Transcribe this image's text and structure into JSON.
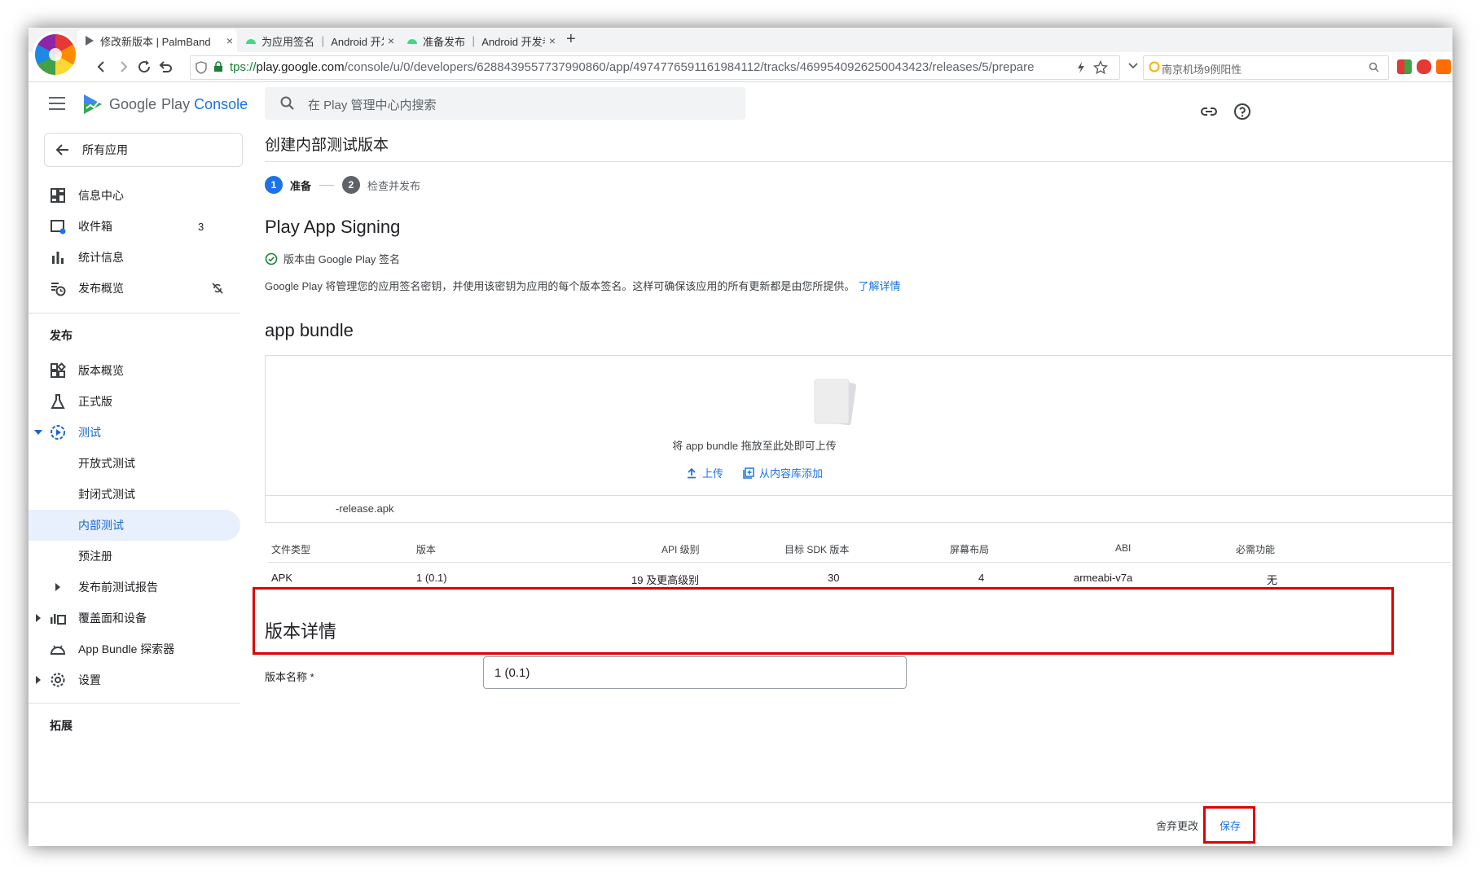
{
  "browser": {
    "tabs": [
      {
        "title": "修改新版本 | PalmBand",
        "active": true
      },
      {
        "title": "为应用签名 ｜ Android 开发者",
        "active": false
      },
      {
        "title": "准备发布 ｜ Android 开发者 ｜",
        "active": false
      }
    ],
    "close_glyph": "×",
    "new_tab_glyph": "+",
    "url_scheme": "tps://",
    "url_host": "play.google.com",
    "url_path": "/console/u/0/developers/6288439557737990860/app/4974776591161984112/tracks/4699540926250043423/releases/5/prepare",
    "search_text": "南京机场9例阳性",
    "colors": {
      "secure": "#188038",
      "accent": "#1a73e8"
    }
  },
  "sidebar": {
    "brand_google": "Google",
    "brand_play": "Play",
    "brand_console": "Console",
    "all_apps_label": "所有应用",
    "items_top": [
      {
        "label": "信息中心",
        "icon": "dashboard-icon"
      },
      {
        "label": "收件箱",
        "icon": "inbox-icon",
        "badge": "3"
      },
      {
        "label": "统计信息",
        "icon": "bar-chart-icon"
      },
      {
        "label": "发布概览",
        "icon": "publishing-overview-icon"
      }
    ],
    "section_release": "发布",
    "items_release": [
      {
        "label": "版本概览",
        "icon": "release-overview-icon"
      },
      {
        "label": "正式版",
        "icon": "production-icon"
      },
      {
        "label": "测试",
        "icon": "testing-icon"
      },
      {
        "label": "开放式测试"
      },
      {
        "label": "封闭式测试"
      },
      {
        "label": "内部测试"
      },
      {
        "label": "预注册"
      },
      {
        "label": "发布前测试报告"
      },
      {
        "label": "覆盖面和设备",
        "icon": "reach-devices-icon"
      },
      {
        "label": "App Bundle 探索器",
        "icon": "bundle-explorer-icon"
      },
      {
        "label": "设置",
        "icon": "settings-icon"
      }
    ],
    "section_grow": "拓展"
  },
  "main": {
    "search_placeholder": "在 Play 管理中心内搜索",
    "page_title": "创建内部测试版本",
    "steps": [
      {
        "num": "1",
        "label": "准备"
      },
      {
        "num": "2",
        "label": "检查并发布"
      }
    ],
    "signing": {
      "heading": "Play App Signing",
      "signed_by": "版本由 Google Play 签名",
      "description": "Google Play 将管理您的应用签名密钥，并使用该密钥为应用的每个版本签名。这样可确保该应用的所有更新都是由您所提供。",
      "learn_more": "了解详情"
    },
    "bundle": {
      "heading": "app bundle",
      "drop_text": "将 app bundle 拖放至此处即可上传",
      "upload_label": "上传",
      "library_label": "从内容库添加",
      "file_name": "-release.apk"
    },
    "details_table": {
      "headers": [
        "文件类型",
        "版本",
        "API 级别",
        "目标 SDK 版本",
        "屏幕布局",
        "ABI",
        "必需功能"
      ],
      "row": [
        "APK",
        "1 (0.1)",
        "19 及更高级别",
        "30",
        "4",
        "armeabi-v7a",
        "无"
      ]
    },
    "release_details": {
      "heading": "版本详情",
      "name_label": "版本名称 *",
      "name_value": "1 (0.1)"
    },
    "footer": {
      "discard_label": "舍弃更改",
      "save_label": "保存"
    },
    "highlight_color": "#e00000"
  }
}
